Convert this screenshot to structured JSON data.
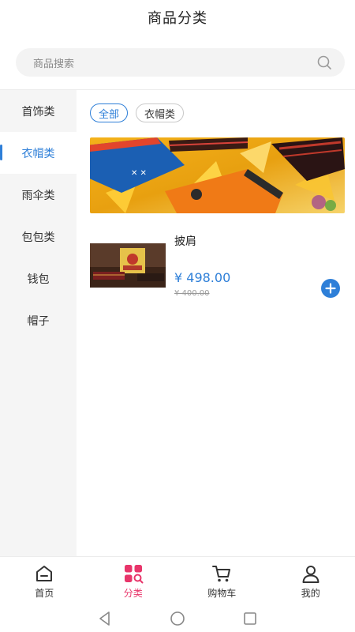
{
  "header": {
    "title": "商品分类"
  },
  "search": {
    "placeholder": "商品搜索"
  },
  "sidebar": {
    "items": [
      {
        "label": "首饰类",
        "active": false
      },
      {
        "label": "衣帽类",
        "active": true
      },
      {
        "label": "雨伞类",
        "active": false
      },
      {
        "label": "包包类",
        "active": false
      },
      {
        "label": "钱包",
        "active": false
      },
      {
        "label": "帽子",
        "active": false
      }
    ]
  },
  "filters": [
    {
      "label": "全部",
      "active": true
    },
    {
      "label": "衣帽类",
      "active": false
    }
  ],
  "product": {
    "name": "披肩",
    "price": "¥ 498.00",
    "old_price": "¥ 400.00"
  },
  "tabbar": {
    "items": [
      {
        "label": "首页",
        "icon": "home-icon"
      },
      {
        "label": "分类",
        "icon": "category-icon"
      },
      {
        "label": "购物车",
        "icon": "cart-icon"
      },
      {
        "label": "我的",
        "icon": "user-icon"
      }
    ]
  },
  "colors": {
    "accent": "#2e7fd8",
    "tab_active": "#e8356a"
  }
}
